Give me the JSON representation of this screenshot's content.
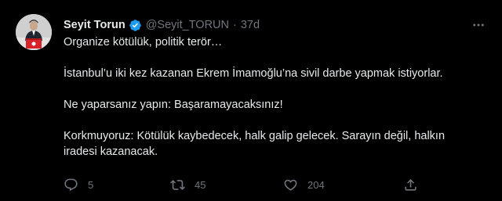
{
  "tweet": {
    "author": {
      "display_name": "Seyit Torun",
      "handle": "@Seyit_TORUN",
      "verified": true,
      "avatar": "profile-photo"
    },
    "separator": "·",
    "timestamp": "37d",
    "lines": [
      "Organize kötülük, politik terör…",
      "İstanbul’u iki kez kazanan Ekrem İmamoğlu’na sivil darbe yapmak istiyorlar.",
      "Ne yaparsanız yapın: Başaramayacaksınız!",
      "Korkmuyoruz: Kötülük kaybedecek, halk galip gelecek. Sarayın değil, halkın",
      "iradesi kazanacak."
    ],
    "actions": {
      "reply_count": "5",
      "retweet_count": "45",
      "like_count": "204"
    }
  },
  "colors": {
    "background": "#000000",
    "text_primary": "#e7e9ea",
    "text_secondary": "#71767b",
    "verified_blue": "#1d9bf0"
  },
  "icons": [
    "more-icon",
    "verified-badge-icon",
    "reply-icon",
    "retweet-icon",
    "like-icon",
    "share-icon"
  ]
}
